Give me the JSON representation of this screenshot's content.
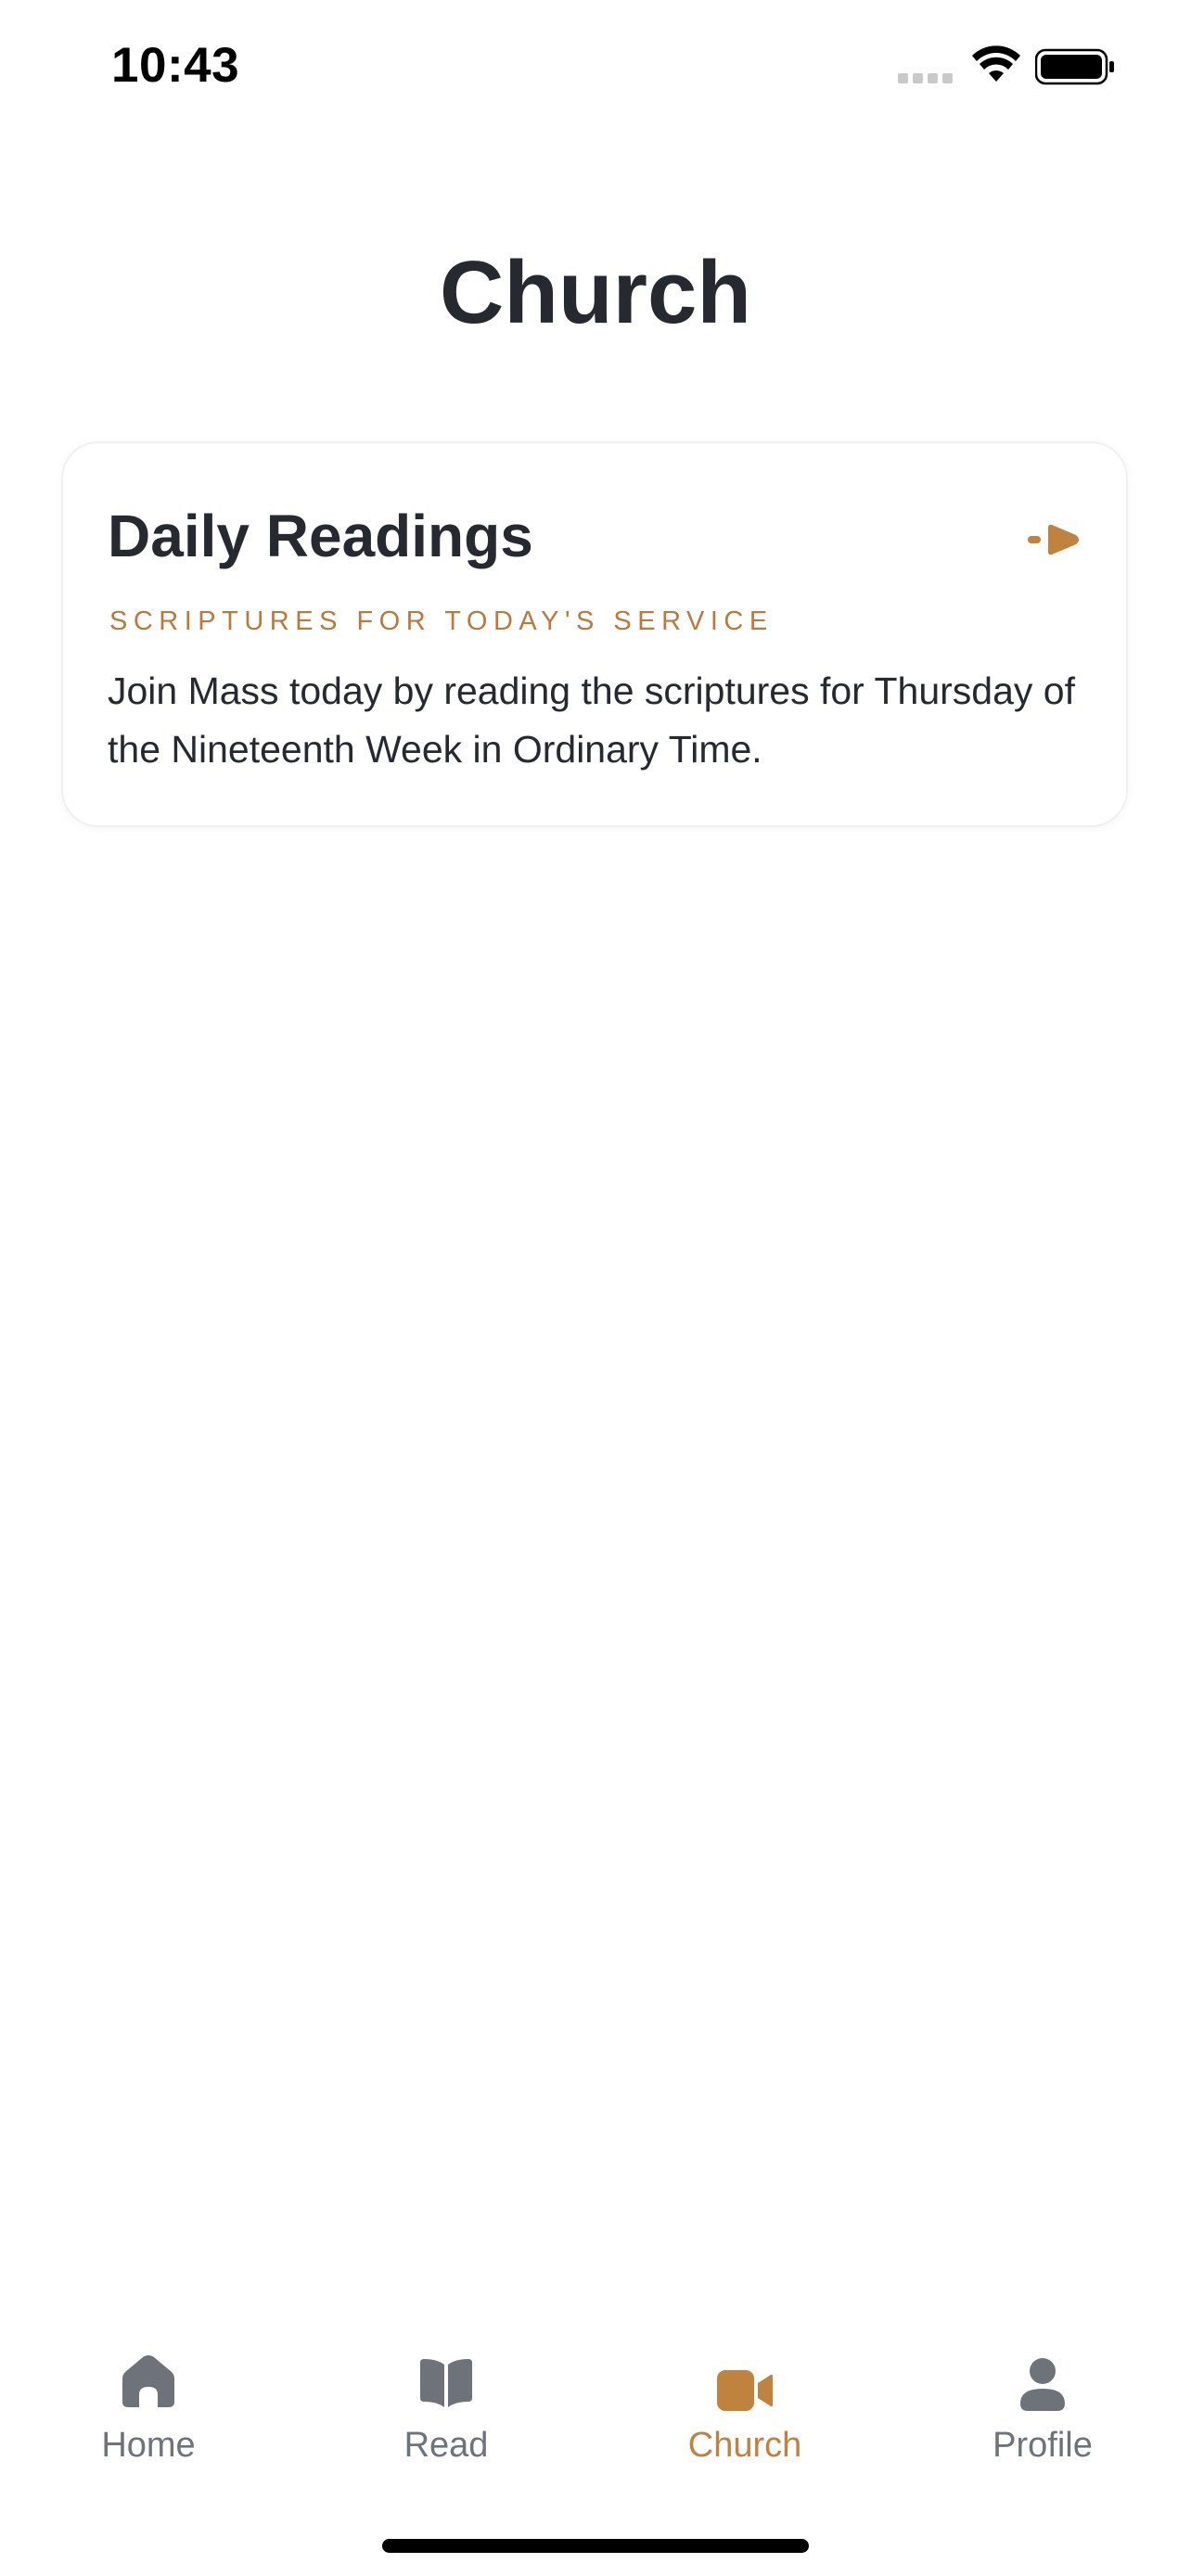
{
  "status_bar": {
    "time": "10:43"
  },
  "header": {
    "title": "Church"
  },
  "card": {
    "title": "Daily Readings",
    "subtitle": "SCRIPTURES FOR TODAY'S SERVICE",
    "body": "Join Mass today by reading the scriptures for Thursday of the Nineteenth Week in Ordinary Time.",
    "arrow_icon": "arrow-right-icon"
  },
  "tabs": [
    {
      "label": "Home",
      "icon": "home-icon",
      "active": false
    },
    {
      "label": "Read",
      "icon": "book-icon",
      "active": false
    },
    {
      "label": "Church",
      "icon": "video-camera-icon",
      "active": true
    },
    {
      "label": "Profile",
      "icon": "person-icon",
      "active": false
    }
  ],
  "colors": {
    "accent": "#c0823f",
    "text": "#262a30",
    "inactive": "#6e737a"
  }
}
